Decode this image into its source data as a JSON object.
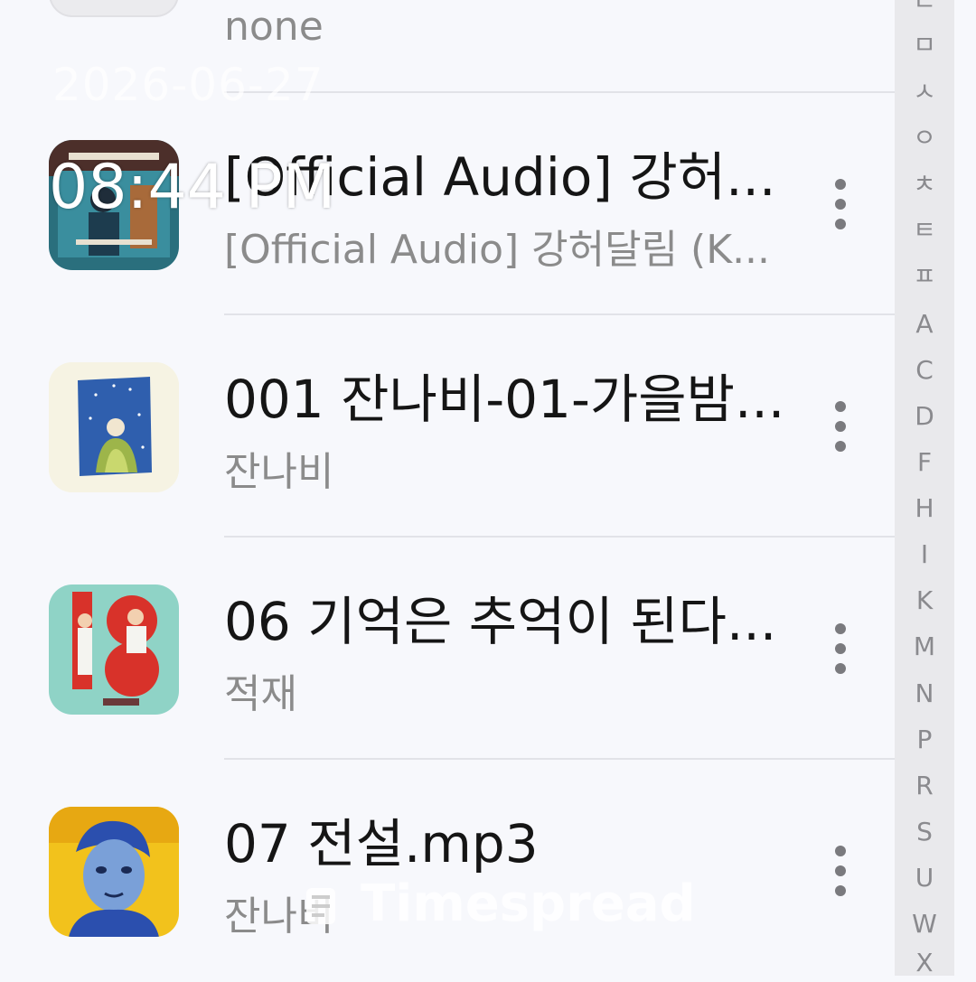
{
  "list": {
    "items": [
      {
        "title": "",
        "subtitle": "none",
        "artwork": "placeholder"
      },
      {
        "title": "[Official Audio] 강허...",
        "subtitle": "[Official Audio] 강허달림 (K...",
        "artwork": "album-teal"
      },
      {
        "title": "001 잔나비-01-가을밤...",
        "subtitle": "잔나비",
        "artwork": "album-blue-figure"
      },
      {
        "title": "06 기억은 추억이 된다...",
        "subtitle": "적재",
        "artwork": "album-18-again"
      },
      {
        "title": "07 전설.mp3",
        "subtitle": "잔나비",
        "artwork": "album-yellow-portrait"
      }
    ],
    "more_icon": "more-vertical-icon"
  },
  "index_bar": {
    "letters": [
      "ㄴ",
      "ㅁ",
      "ㅅ",
      "ㅇ",
      "ㅊ",
      "ㅌ",
      "ㅍ",
      "A",
      "C",
      "D",
      "F",
      "H",
      "I",
      "K",
      "M",
      "N",
      "P",
      "R",
      "S",
      "U",
      "W",
      "X"
    ]
  },
  "overlay": {
    "date": "2026-06-27",
    "time": "08:44 PM"
  },
  "watermark": {
    "text": "Timespread",
    "icon": "timespread-logo-icon"
  }
}
